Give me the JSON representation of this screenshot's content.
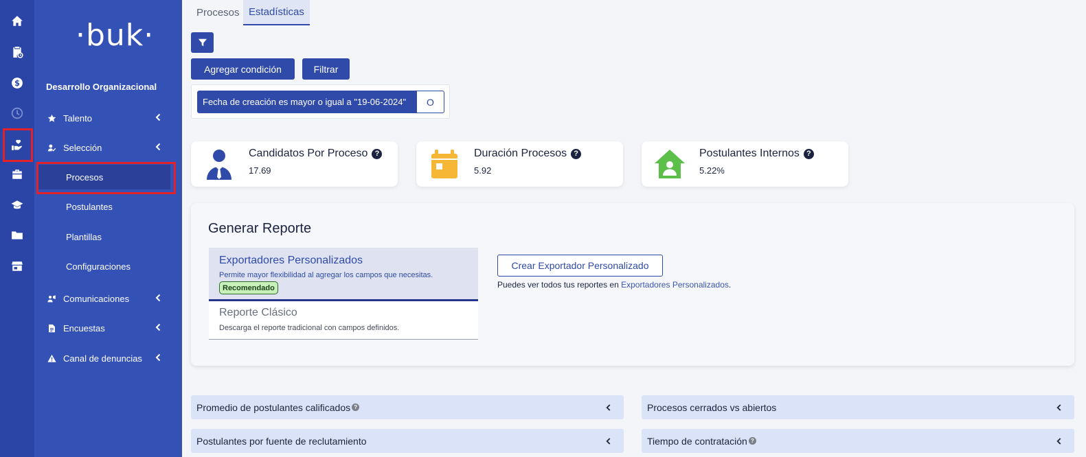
{
  "brand": {
    "logo": "·buk·"
  },
  "sidebar": {
    "org": "Desarrollo Organizacional",
    "items": [
      {
        "label": "Talento",
        "icon": "star-icon"
      },
      {
        "label": "Selección",
        "icon": "user-check-icon"
      },
      {
        "label": "Comunicaciones",
        "icon": "megaphone-icon"
      },
      {
        "label": "Encuestas",
        "icon": "document-icon"
      },
      {
        "label": "Canal de denuncias",
        "icon": "warning-icon"
      }
    ],
    "subitems": [
      {
        "label": "Procesos",
        "active": true
      },
      {
        "label": "Postulantes"
      },
      {
        "label": "Plantillas"
      },
      {
        "label": "Configuraciones"
      }
    ]
  },
  "tabs": [
    {
      "label": "Procesos"
    },
    {
      "label": "Estadísticas",
      "active": true
    }
  ],
  "toolbar": {
    "add_condition": "Agregar condición",
    "filter": "Filtrar"
  },
  "condition": {
    "text": "Fecha de creación es mayor o igual a \"19-06-2024\"",
    "or_label": "O"
  },
  "kpis": [
    {
      "title": "Candidatos Por Proceso",
      "value": "17.69",
      "icon": "person-tie-icon",
      "color": "#2f4aa8"
    },
    {
      "title": "Duración Procesos",
      "value": "5.92",
      "icon": "calendar-icon",
      "color": "#f6b636"
    },
    {
      "title": "Postulantes Internos",
      "value": "5.22%",
      "icon": "home-user-icon",
      "color": "#5cbf4a"
    }
  ],
  "report": {
    "title": "Generar Reporte",
    "option1": {
      "title": "Exportadores Personalizados",
      "desc": "Permite mayor flexibilidad al agregar los campos que necesitas.",
      "badge": "Recomendado"
    },
    "option2": {
      "title": "Reporte Clásico",
      "desc": "Descarga el reporte tradicional con campos definidos."
    },
    "create_button": "Crear Exportador Personalizado",
    "note_prefix": "Puedes ver todos tus reportes en ",
    "note_link": "Exportadores Personalizados",
    "note_suffix": "."
  },
  "accordions": [
    {
      "label": "Promedio de postulantes calificados",
      "help": "?"
    },
    {
      "label": "Procesos cerrados vs abiertos"
    },
    {
      "label": "Postulantes por fuente de reclutamiento"
    },
    {
      "label": "Tiempo de contratación",
      "help": "?"
    }
  ],
  "colors": {
    "rail": "#2a45a6",
    "sidebar": "#3451b6",
    "primary": "#2f4aa8",
    "highlight": "#e3212b"
  }
}
